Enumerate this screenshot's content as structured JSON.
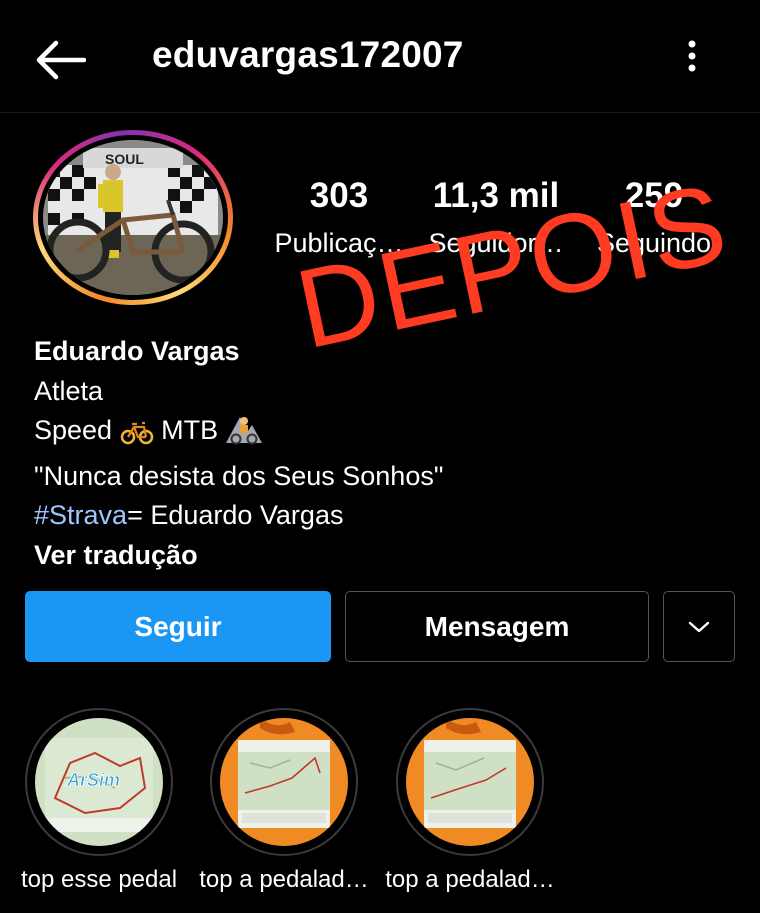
{
  "header": {
    "back_icon": "arrow-left-icon",
    "username": "eduvargas172007",
    "more_icon": "more-vertical-icon"
  },
  "profile": {
    "avatar_icon": "profile-photo-cyclist",
    "stats": [
      {
        "value": "303",
        "label": "Publicaç…"
      },
      {
        "value": "11,3 mil",
        "label": "Seguidor…"
      },
      {
        "value": "259",
        "label": "Seguindo"
      }
    ],
    "name": "Eduardo Vargas",
    "category": "Atleta",
    "line3_speed": "Speed",
    "line3_mtb": "MTB",
    "quote": "\"Nunca desista dos Seus Sonhos\"",
    "hashtag": "#Strava",
    "strava_rest": "= Eduardo Vargas",
    "translate": "Ver tradução"
  },
  "overlay": {
    "text": "DEPOIS",
    "color": "#ff3b22"
  },
  "actions": {
    "follow": "Seguir",
    "message": "Mensagem",
    "dropdown_icon": "chevron-down-icon"
  },
  "highlights": [
    {
      "label": "top esse pedal",
      "map_text": "ArSim"
    },
    {
      "label": "top a pedalad…"
    },
    {
      "label": "top a pedalad…"
    }
  ],
  "colors": {
    "background": "#000000",
    "follow_button": "#1a96f5",
    "hashtag": "#9fc6ff"
  }
}
